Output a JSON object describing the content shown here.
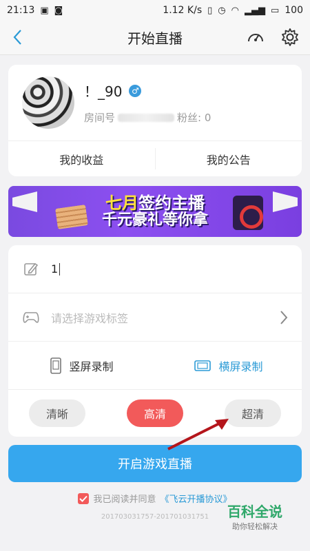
{
  "status_bar": {
    "time": "21:13",
    "speed": "1.12 K/s",
    "battery": "100"
  },
  "nav": {
    "title": "开始直播",
    "back_icon": "chevron-left-icon",
    "speed_icon": "speedometer-icon",
    "settings_icon": "gear-icon"
  },
  "profile": {
    "name": "！_90",
    "gender_icon": "male-icon",
    "room_label": "房间号",
    "fans_label": "粉丝: 0",
    "earnings_label": "我的收益",
    "notice_label": "我的公告"
  },
  "banner": {
    "line1_highlight": "七月",
    "line1_rest": "签约主播",
    "line2": "千元豪礼等你拿"
  },
  "form": {
    "title_value": "1",
    "game_tag_placeholder": "请选择游戏标签",
    "portrait_label": "竖屏录制",
    "landscape_label": "横屏录制",
    "selected_orientation": "landscape",
    "quality_options": [
      "清晰",
      "高清",
      "超清"
    ],
    "selected_quality": "高清"
  },
  "start_button_label": "开启游戏直播",
  "agreement": {
    "checked": true,
    "text": "我已阅读并同意",
    "link": "《飞云开播协议》"
  },
  "version": "201703031757-201701031751",
  "watermark": {
    "line1": "百科全说",
    "line2": "助你轻松解决"
  },
  "colors": {
    "accent_blue": "#36a7ee",
    "accent_red": "#f25a5a",
    "banner_purple": "#8c4ff0"
  }
}
